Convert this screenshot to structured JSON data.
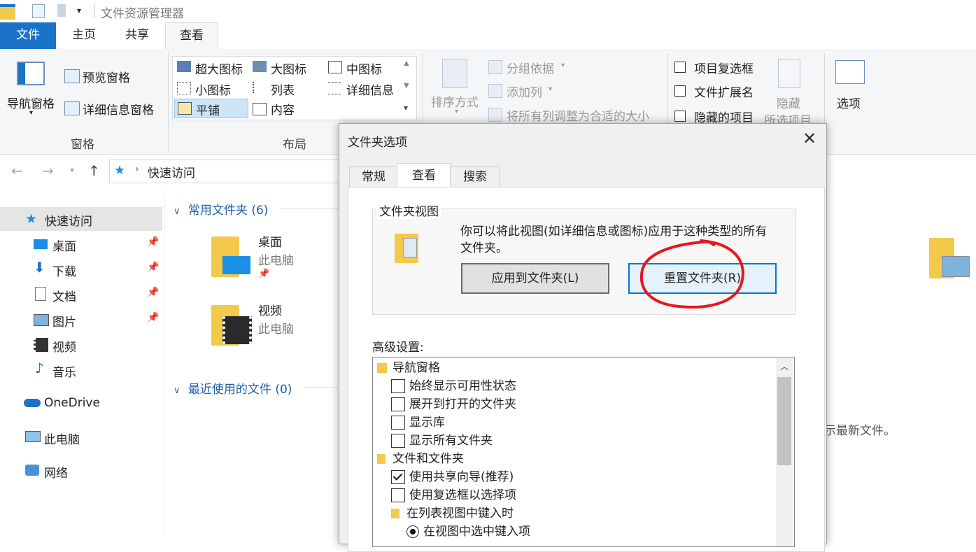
{
  "window": {
    "title": "文件资源管理器"
  },
  "ribbon_tabs": [
    "文件",
    "主页",
    "共享",
    "查看"
  ],
  "ribbon": {
    "panes_group": {
      "nav_pane": "导航窗格",
      "preview_pane": "预览窗格",
      "details_pane": "详细信息窗格",
      "label": "窗格"
    },
    "layout_group": {
      "items": [
        "超大图标",
        "大图标",
        "中图标",
        "小图标",
        "列表",
        "详细信息",
        "平铺",
        "内容"
      ],
      "selected": "平铺",
      "label": "布局"
    },
    "current_view_group": {
      "sort_by": "排序方式",
      "group_by": "分组依据",
      "add_column": "添加列",
      "fit_columns": "将所有列调整为合适的大小"
    },
    "show_hide_group": {
      "item_checkboxes": "项目复选框",
      "file_extensions": "文件扩展名",
      "hidden_items": "隐藏的项目",
      "hide_selected_1": "隐藏",
      "hide_selected_2": "所选项目"
    },
    "options_label": "选项"
  },
  "address": {
    "path": "快速访问"
  },
  "nav_pane": {
    "items": [
      {
        "label": "快速访问",
        "icon": "star-icon"
      },
      {
        "label": "桌面",
        "icon": "desktop-icon",
        "pinned": true
      },
      {
        "label": "下载",
        "icon": "download-icon",
        "pinned": true
      },
      {
        "label": "文档",
        "icon": "document-icon",
        "pinned": true
      },
      {
        "label": "图片",
        "icon": "picture-icon",
        "pinned": true
      },
      {
        "label": "视频",
        "icon": "video-icon"
      },
      {
        "label": "音乐",
        "icon": "music-icon"
      },
      {
        "label": "OneDrive",
        "icon": "cloud-icon"
      },
      {
        "label": "此电脑",
        "icon": "computer-icon"
      },
      {
        "label": "网络",
        "icon": "network-icon"
      }
    ]
  },
  "content": {
    "frequent_header": "常用文件夹 (6)",
    "recent_header": "最近使用的文件 (0)",
    "folders": [
      {
        "name": "桌面",
        "location": "此电脑"
      },
      {
        "name": "视频",
        "location": "此电脑"
      }
    ],
    "recent_hint": "示最新文件。"
  },
  "dialog": {
    "title": "文件夹选项",
    "tabs": [
      "常规",
      "查看",
      "搜索"
    ],
    "active_tab": "查看",
    "folder_views_label": "文件夹视图",
    "folder_views_desc_1": "你可以将此视图(如详细信息或图标)应用于这种类型的所有",
    "folder_views_desc_2": "文件夹。",
    "apply_button": "应用到文件夹(L)",
    "reset_button": "重置文件夹(R)",
    "advanced_label": "高级设置:",
    "advanced_items": [
      {
        "label": "导航窗格",
        "kind": "folder"
      },
      {
        "label": "始终显示可用性状态",
        "kind": "checkbox",
        "checked": false
      },
      {
        "label": "展开到打开的文件夹",
        "kind": "checkbox",
        "checked": false
      },
      {
        "label": "显示库",
        "kind": "checkbox",
        "checked": false
      },
      {
        "label": "显示所有文件夹",
        "kind": "checkbox",
        "checked": false
      },
      {
        "label": "文件和文件夹",
        "kind": "folder"
      },
      {
        "label": "使用共享向导(推荐)",
        "kind": "checkbox",
        "checked": true
      },
      {
        "label": "使用复选框以选择项",
        "kind": "checkbox",
        "checked": false
      },
      {
        "label": "在列表视图中键入时",
        "kind": "folder"
      },
      {
        "label": "在视图中选中键入项",
        "kind": "radio",
        "checked": true
      }
    ]
  },
  "colors": {
    "accent": "#1a73c8",
    "annotation": "#e8171d",
    "folder": "#f3c94b"
  }
}
